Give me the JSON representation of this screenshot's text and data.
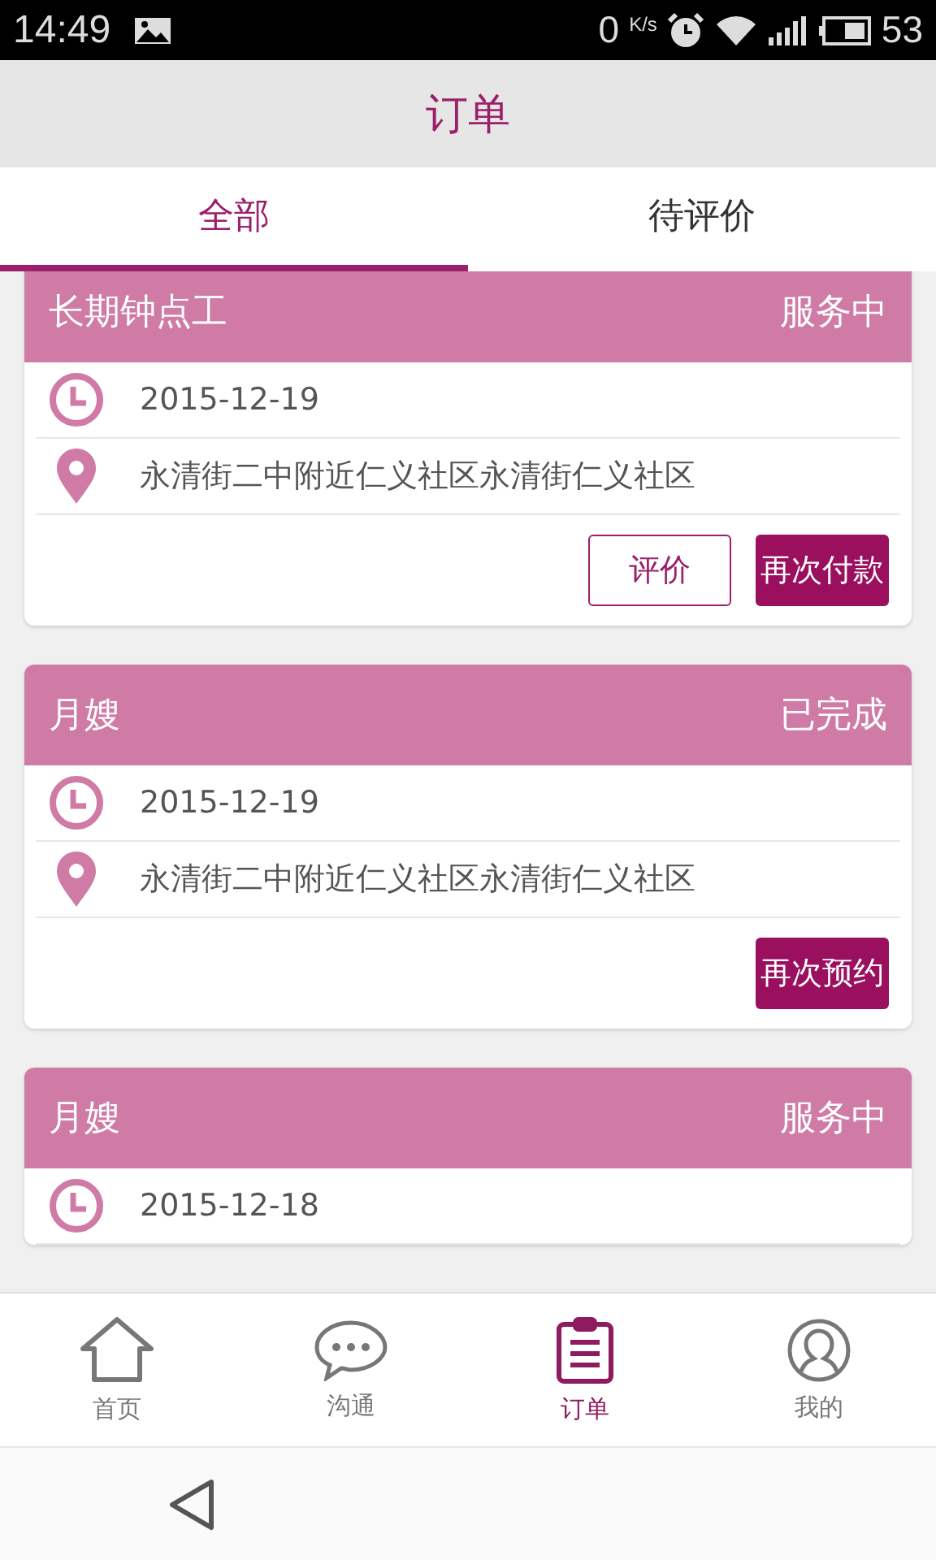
{
  "status_bar": {
    "time": "14:49",
    "speed": "0",
    "speed_unit": "K/s",
    "battery": "53"
  },
  "header": {
    "title": "订单"
  },
  "tabs": [
    {
      "label": "全部",
      "selected": true
    },
    {
      "label": "待评价",
      "selected": false
    }
  ],
  "orders": [
    {
      "service": "长期钟点工",
      "status": "服务中",
      "date": "2015-12-19",
      "address": "永清街二中附近仁义社区永清街仁义社区",
      "buttons": [
        {
          "label": "评价",
          "kind": "outline"
        },
        {
          "label": "再次付款",
          "kind": "filled"
        }
      ]
    },
    {
      "service": "月嫂",
      "status": "已完成",
      "date": "2015-12-19",
      "address": "永清街二中附近仁义社区永清街仁义社区",
      "buttons": [
        {
          "label": "再次预约",
          "kind": "filled"
        }
      ]
    },
    {
      "service": "月嫂",
      "status": "服务中",
      "date": "2015-12-18"
    }
  ],
  "bottom_nav": [
    {
      "label": "首页",
      "kind": "home",
      "selected": false
    },
    {
      "label": "沟通",
      "kind": "chat",
      "selected": false
    },
    {
      "label": "订单",
      "kind": "orders",
      "selected": true
    },
    {
      "label": "我的",
      "kind": "profile",
      "selected": false
    }
  ]
}
